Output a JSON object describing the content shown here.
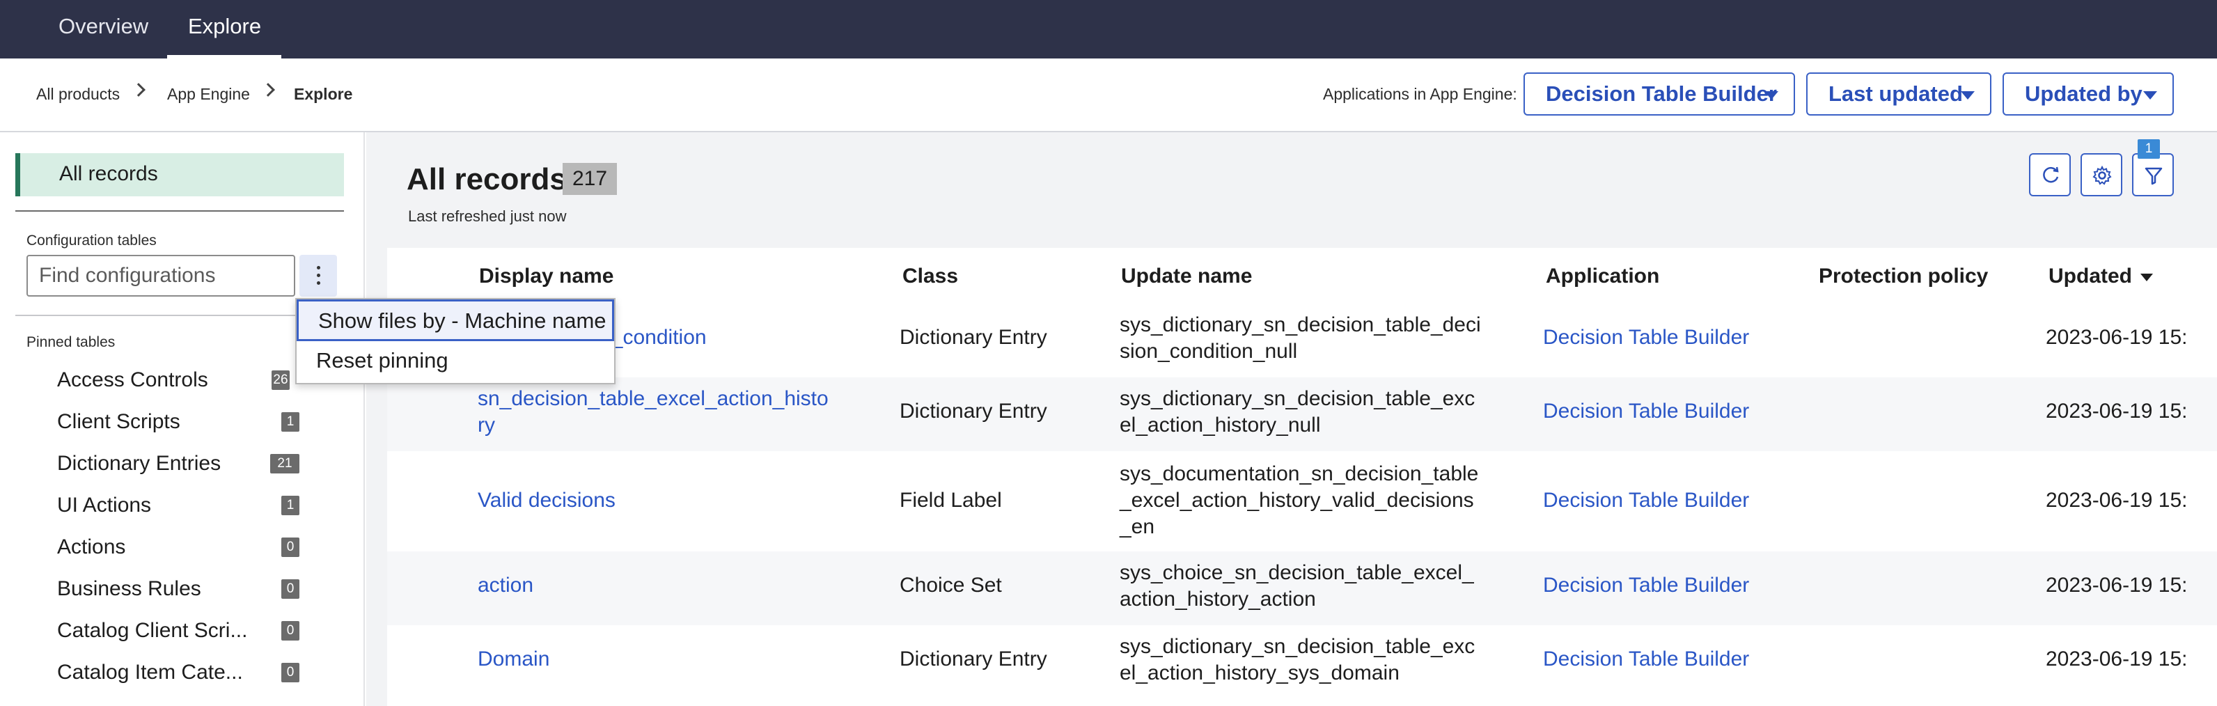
{
  "topnav": {
    "tabs": [
      "Overview",
      "Explore"
    ],
    "active": "Explore"
  },
  "breadcrumb": [
    "All products",
    "App Engine",
    "Explore"
  ],
  "header": {
    "apps_label": "Applications in App Engine:",
    "filters": [
      "Decision Table Builder",
      "Last updated",
      "Updated by"
    ]
  },
  "sidebar": {
    "all_records": "All records",
    "config_label": "Configuration tables",
    "find_placeholder": "Find configurations",
    "pinned_label": "Pinned tables",
    "pinned": [
      {
        "label": "Access Controls",
        "count": "26"
      },
      {
        "label": "Client Scripts",
        "count": "1"
      },
      {
        "label": "Dictionary Entries",
        "count": "21"
      },
      {
        "label": "UI Actions",
        "count": "1"
      },
      {
        "label": "Actions",
        "count": "0"
      },
      {
        "label": "Business Rules",
        "count": "0"
      },
      {
        "label": "Catalog Client Scri...",
        "count": "0"
      },
      {
        "label": "Catalog Item Cate...",
        "count": "0"
      }
    ]
  },
  "menu": {
    "items": [
      "Show files by - Machine name",
      "Reset pinning"
    ]
  },
  "main": {
    "title": "All records",
    "count": "217",
    "refreshed": "Last refreshed just now",
    "filter_badge": "1",
    "columns": [
      "Display name",
      "Class",
      "Update name",
      "Application",
      "Protection policy",
      "Updated"
    ],
    "rows": [
      {
        "display": "...ble_decision_condition",
        "class": "Dictionary Entry",
        "update": "sys_dictionary_sn_decision_table_decision_condition_null",
        "application": "Decision Table Builder",
        "protection": "",
        "updated": "2023-06-19 15:"
      },
      {
        "display": "sn_decision_table_excel_action_history",
        "class": "Dictionary Entry",
        "update": "sys_dictionary_sn_decision_table_excel_action_history_null",
        "application": "Decision Table Builder",
        "protection": "",
        "updated": "2023-06-19 15:"
      },
      {
        "display": "Valid decisions",
        "class": "Field Label",
        "update": "sys_documentation_sn_decision_table_excel_action_history_valid_decisions_en",
        "application": "Decision Table Builder",
        "protection": "",
        "updated": "2023-06-19 15:"
      },
      {
        "display": "action",
        "class": "Choice Set",
        "update": "sys_choice_sn_decision_table_excel_action_history_action",
        "application": "Decision Table Builder",
        "protection": "",
        "updated": "2023-06-19 15:"
      },
      {
        "display": "Domain",
        "class": "Dictionary Entry",
        "update": "sys_dictionary_sn_decision_table_excel_action_history_sys_domain",
        "application": "Decision Table Builder",
        "protection": "",
        "updated": "2023-06-19 15:"
      }
    ]
  },
  "colors": {
    "nav_bg": "#2e3249",
    "accent": "#3a61c6",
    "link": "#2a56c6",
    "active_item": "#d8eee4",
    "active_border": "#27775b"
  }
}
